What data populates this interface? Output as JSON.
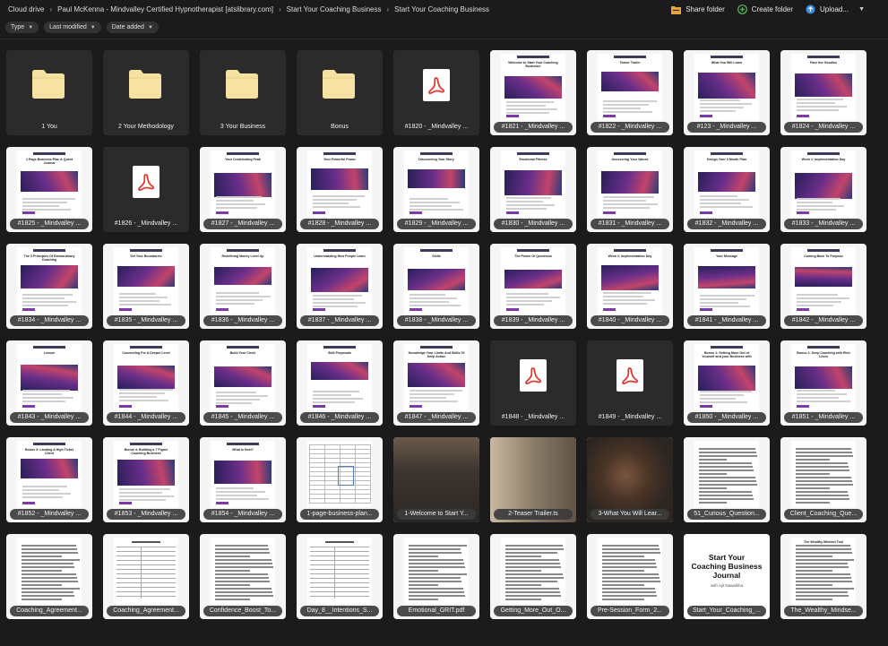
{
  "breadcrumb": [
    "Cloud drive",
    "Paul McKenna - Mindvalley Certified Hypnotherapist [atslibrary.com]",
    "Start Your Coaching Business",
    "Start Your Coaching Business"
  ],
  "actions": {
    "share": "Share folder",
    "create": "Create folder",
    "upload": "Upload..."
  },
  "filters": [
    "Type",
    "Last modified",
    "Date added"
  ],
  "colors": {
    "background": "#1b1b1b",
    "folder": "#f6e3a3",
    "pdf_red": "#e03a2f",
    "share_icon": "#e6a23c",
    "create_icon": "#5cb85c",
    "upload_icon": "#3b8fe0"
  },
  "tiles": [
    {
      "name": "1 You",
      "kind": "folder"
    },
    {
      "name": "2 Your Methodology",
      "kind": "folder"
    },
    {
      "name": "3 Your Business",
      "kind": "folder"
    },
    {
      "name": "Bonus",
      "kind": "folder"
    },
    {
      "name": "#1820 - _Mindvalley ...",
      "kind": "pdf"
    },
    {
      "name": "#1821 - _Mindvalley ...",
      "kind": "doc",
      "title": "Welcome to Start Your Coaching Business!"
    },
    {
      "name": "#1822 - _Mindvalley ...",
      "kind": "doc",
      "title": "Teaser Trailer"
    },
    {
      "name": "#123 - _Mindvalley ...",
      "kind": "doc",
      "title": "What You Will Learn"
    },
    {
      "name": "#1824 - _Mindvalley ...",
      "kind": "doc",
      "title": "Face the Goodies"
    },
    {
      "name": "#1825 - _Mindvalley ...",
      "kind": "doc",
      "title": "1 Page Business Plan & Quest Journal"
    },
    {
      "name": "#1826 - _Mindvalley ...",
      "kind": "pdf"
    },
    {
      "name": "#1827 - _Mindvalley ...",
      "kind": "doc",
      "title": "Your Contributing Peak"
    },
    {
      "name": "#1828 - _Mindvalley ...",
      "kind": "doc",
      "title": "Your Powerful Power"
    },
    {
      "name": "#1829 - _Mindvalley ...",
      "kind": "doc",
      "title": "Discovering Your Story"
    },
    {
      "name": "#1830 - _Mindvalley ...",
      "kind": "doc",
      "title": "Emotional Fitness"
    },
    {
      "name": "#1831 - _Mindvalley ...",
      "kind": "doc",
      "title": "Uncovering Your Values"
    },
    {
      "name": "#1832 - _Mindvalley ...",
      "kind": "doc",
      "title": "Design Your 3 Month Plan"
    },
    {
      "name": "#1833 - _Mindvalley ...",
      "kind": "doc",
      "title": "Week 1: Implementation Day"
    },
    {
      "name": "#1834 - _Mindvalley ...",
      "kind": "doc",
      "title": "The 3 Principles Of Extraordinary Coaching"
    },
    {
      "name": "#1835 - _Mindvalley ...",
      "kind": "doc",
      "title": "Set Your Boundaries"
    },
    {
      "name": "#1836 - _Mindvalley ...",
      "kind": "doc",
      "title": "Redefining Money Level Up"
    },
    {
      "name": "#1837 - _Mindvalley ...",
      "kind": "doc",
      "title": "Understanding How People Learn"
    },
    {
      "name": "#1838 - _Mindvalley ...",
      "kind": "doc",
      "title": "Skills"
    },
    {
      "name": "#1839 - _Mindvalley ...",
      "kind": "doc",
      "title": "The Power Of Questions"
    },
    {
      "name": "#1840 - _Mindvalley ...",
      "kind": "doc",
      "title": "Week 2: Implementation Day"
    },
    {
      "name": "#1841 - _Mindvalley ...",
      "kind": "doc",
      "title": "Your Message"
    },
    {
      "name": "#1842 - _Mindvalley ...",
      "kind": "doc",
      "title": "Coming Back To Purpose"
    },
    {
      "name": "#1843 - _Mindvalley ...",
      "kind": "doc",
      "title": "Lesson"
    },
    {
      "name": "#1844 - _Mindvalley ...",
      "kind": "doc",
      "title": "Connecting For A Deeper Level"
    },
    {
      "name": "#1845 - _Mindvalley ...",
      "kind": "doc",
      "title": "Build Your Circle"
    },
    {
      "name": "#1846 - _Mindvalley ...",
      "kind": "doc",
      "title": "Skill Proposals"
    },
    {
      "name": "#1847 - _Mindvalley ...",
      "kind": "doc",
      "title": "Knowledge Your Limits And Skills Of Deep Action"
    },
    {
      "name": "#1848 - _Mindvalley ...",
      "kind": "pdf"
    },
    {
      "name": "#1849 - _Mindvalley ...",
      "kind": "pdf"
    },
    {
      "name": "#1850 - _Mindvalley ...",
      "kind": "doc",
      "title": "Bonus 1: Getting More Out of Yourself and your Business with Michael Neil"
    },
    {
      "name": "#1851 - _Mindvalley ...",
      "kind": "doc",
      "title": "Bonus 2: Deep Coaching with Rich Litvin"
    },
    {
      "name": "#1852 - _Mindvalley ...",
      "kind": "doc",
      "title": "Bonus 3: Landing A High Ticket Client"
    },
    {
      "name": "#1853 - _Mindvalley ...",
      "kind": "doc",
      "title": "Bonus 4: Building a 7 Figure Coaching Business"
    },
    {
      "name": "#1854 - _Mindvalley ...",
      "kind": "doc",
      "title": "What Is Next?"
    },
    {
      "name": "1-page-business-plan...",
      "kind": "sheet"
    },
    {
      "name": "1-Welcome to Start Y...",
      "kind": "video"
    },
    {
      "name": "2-Teaser Trailer.ts",
      "kind": "video"
    },
    {
      "name": "3-What You Will Lear...",
      "kind": "video"
    },
    {
      "name": "51_Curious_Question...",
      "kind": "text"
    },
    {
      "name": "Client_Coaching_Que...",
      "kind": "text"
    },
    {
      "name": "Coaching_Agreement...",
      "kind": "text"
    },
    {
      "name": "Coaching_Agreement...",
      "kind": "form"
    },
    {
      "name": "Confidence_Boost_To...",
      "kind": "text"
    },
    {
      "name": "Day_8__Intentions_S...",
      "kind": "form"
    },
    {
      "name": "Emotional_GRIT.pdf",
      "kind": "text"
    },
    {
      "name": "Getting_More_Out_O...",
      "kind": "text"
    },
    {
      "name": "Pre-Session_Form_2...",
      "kind": "text"
    },
    {
      "name": "Start_Your_Coaching_...",
      "kind": "cover",
      "cover_title": "Start Your Coaching Business Journal",
      "cover_sub": "with Ajit Nawalkha"
    },
    {
      "name": "The_Wealthy_Mindse...",
      "kind": "text",
      "title": "The Wealthy Mindset Tool"
    }
  ]
}
